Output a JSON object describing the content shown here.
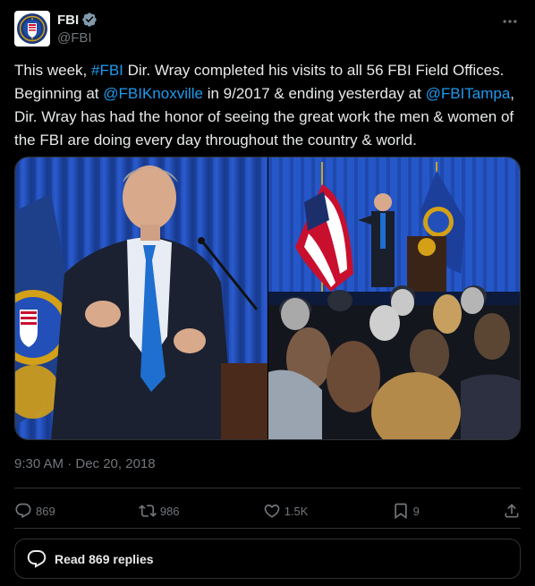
{
  "account": {
    "display_name": "FBI",
    "handle": "@FBI"
  },
  "tweet": {
    "parts": [
      {
        "text": "This week, ",
        "link": false
      },
      {
        "text": "#FBI",
        "link": true
      },
      {
        "text": " Dir. Wray completed his visits to all 56 FBI Field Offices. Beginning at ",
        "link": false
      },
      {
        "text": "@FBIKnoxville",
        "link": true
      },
      {
        "text": " in 9/2017 & ending yesterday at ",
        "link": false
      },
      {
        "text": "@FBITampa",
        "link": true
      },
      {
        "text": ", Dir. Wray has had the honor of seeing the great work the men & women of the FBI are doing every day throughout the country & world.",
        "link": false
      }
    ],
    "timestamp": "9:30 AM · Dec 20, 2018"
  },
  "media": {
    "photos": [
      "speaker-closeup-photo",
      "auditorium-audience-photo"
    ]
  },
  "actions": {
    "replies": "869",
    "reposts": "986",
    "likes": "1.5K",
    "bookmarks": "9"
  },
  "read_replies": {
    "label": "Read 869 replies"
  },
  "colors": {
    "background": "#000000",
    "text": "#e7e9ea",
    "muted": "#71767b",
    "link": "#1d9bf0",
    "border": "#2f3336"
  }
}
